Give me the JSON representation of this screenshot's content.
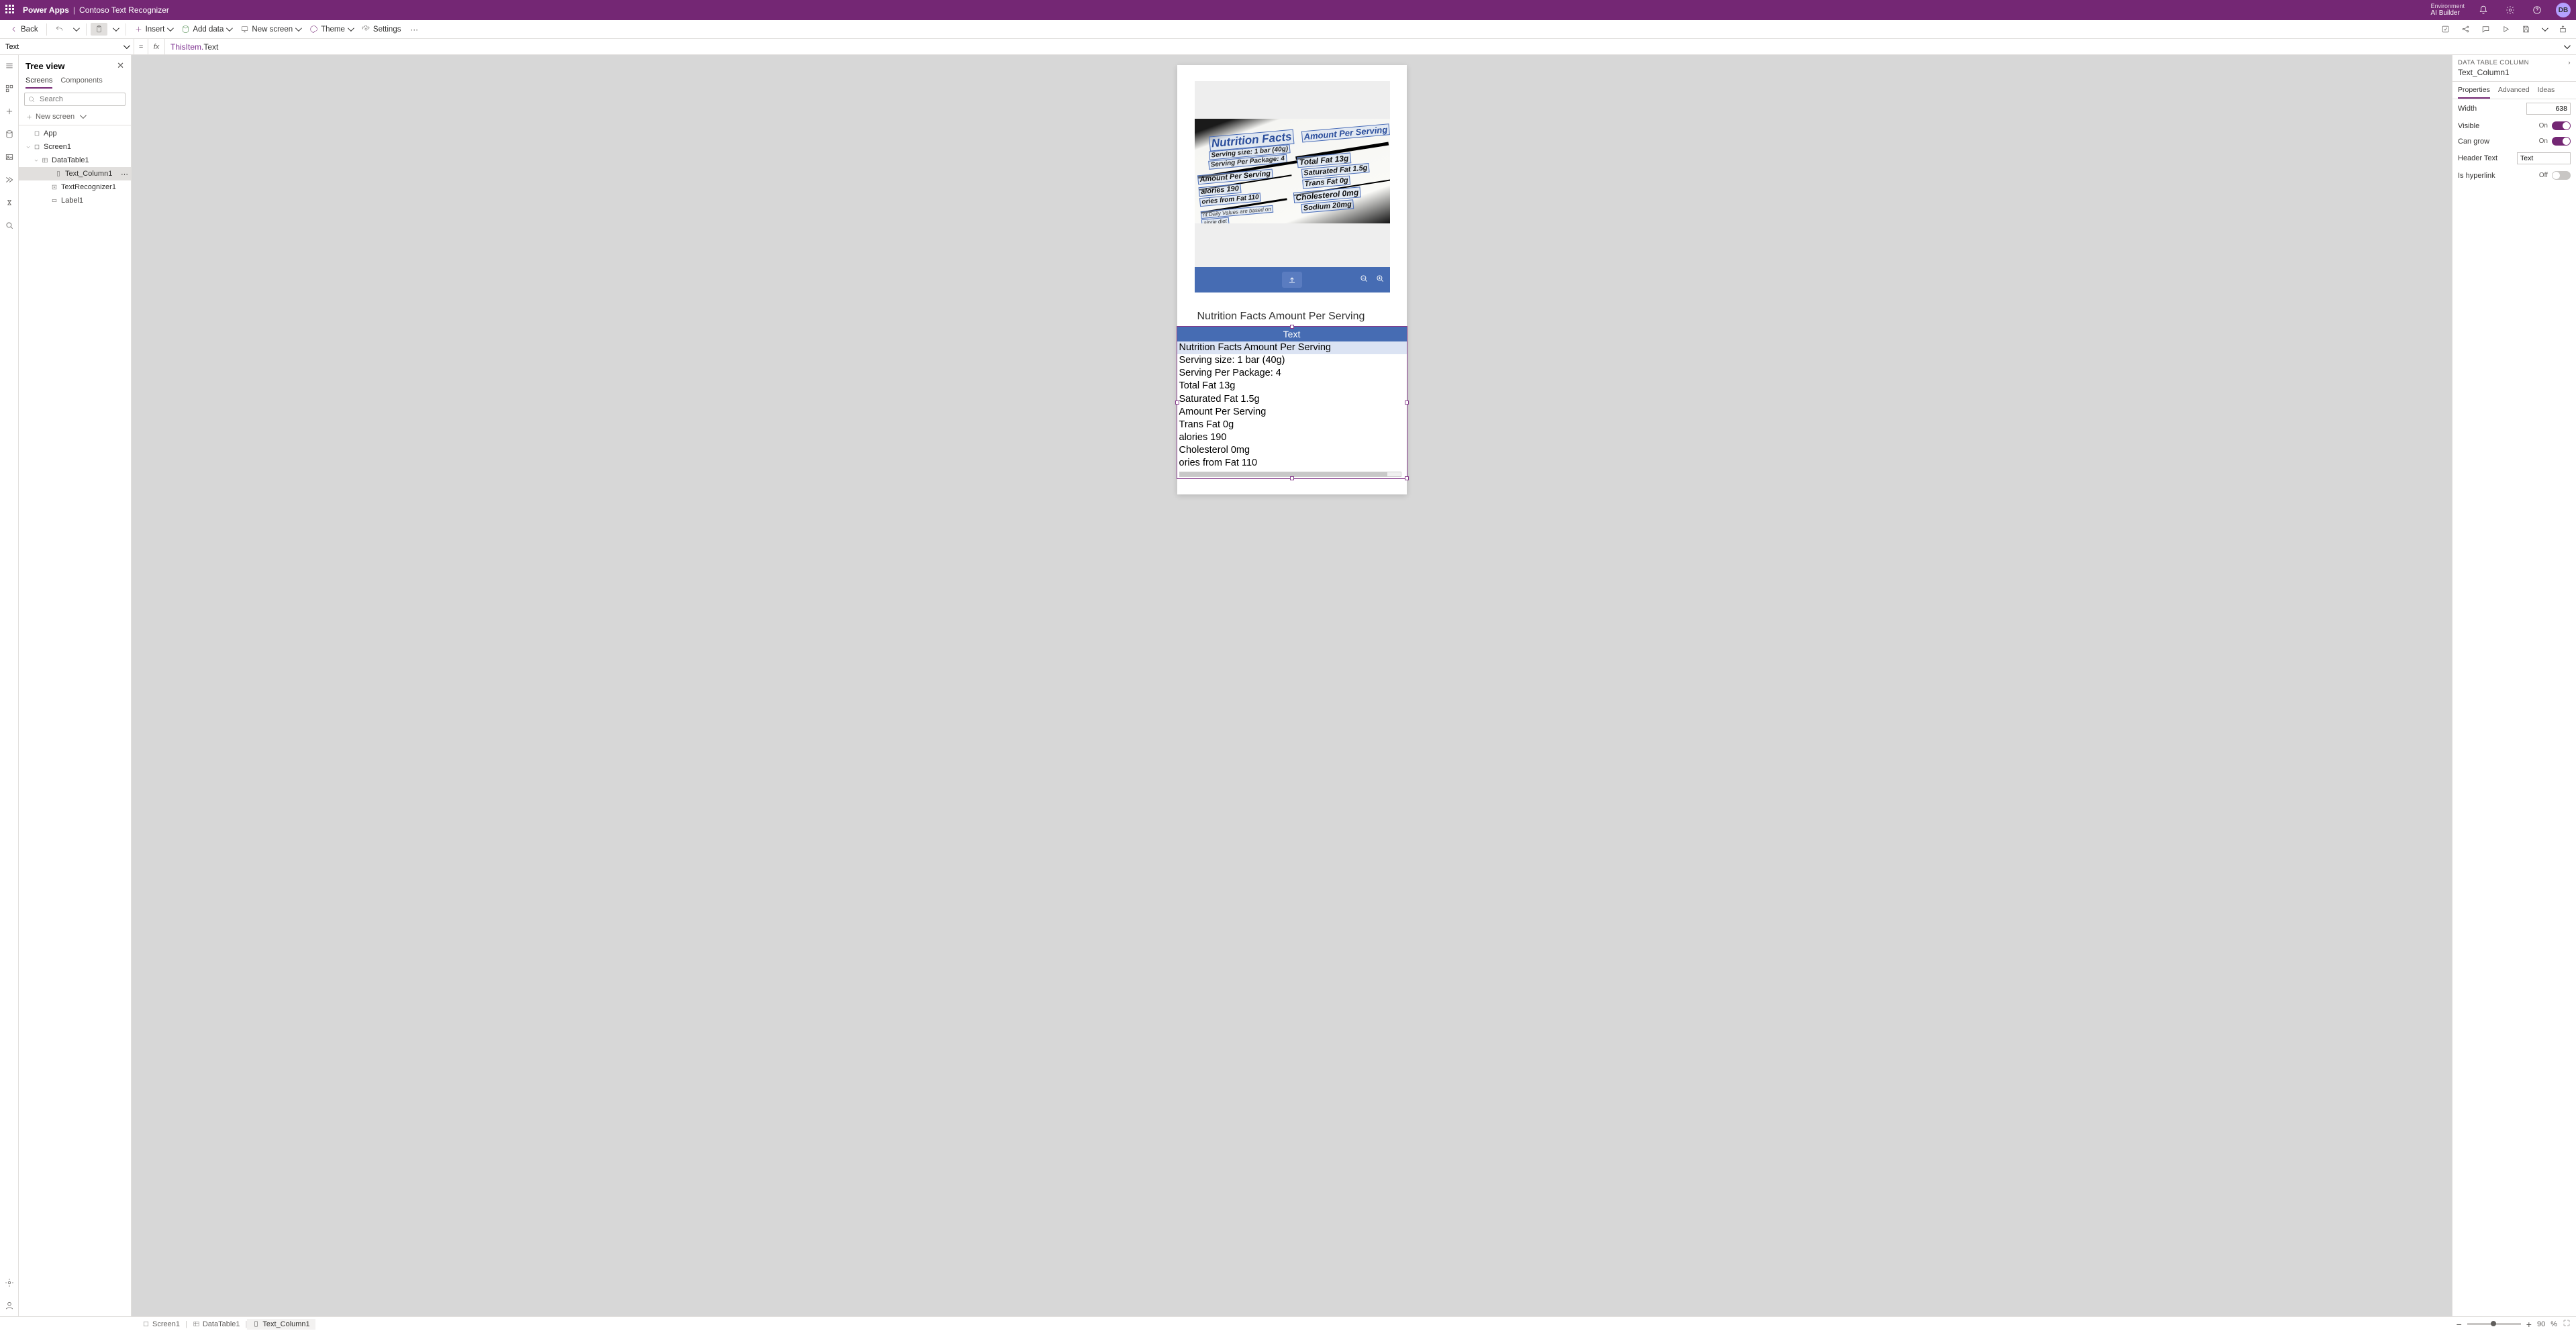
{
  "header": {
    "brand": "Power Apps",
    "appName": "Contoso Text Recognizer",
    "envLabel": "Environment",
    "envName": "AI Builder",
    "avatar": "DB"
  },
  "ribbon": {
    "back": "Back",
    "insert": "Insert",
    "addData": "Add data",
    "newScreen": "New screen",
    "theme": "Theme",
    "settings": "Settings"
  },
  "formula": {
    "property": "Text",
    "prefix": "ThisItem.",
    "suffix": "Text"
  },
  "treeview": {
    "title": "Tree view",
    "tabs": {
      "screens": "Screens",
      "components": "Components"
    },
    "searchPlaceholder": "Search",
    "newScreen": "New screen",
    "nodes": {
      "app": "App",
      "screen1": "Screen1",
      "dataTable1": "DataTable1",
      "textColumn1": "Text_Column1",
      "textRecognizer1": "TextRecognizer1",
      "label1": "Label1"
    }
  },
  "canvas": {
    "labelText": "Nutrition Facts Amount Per Serving",
    "columnHeader": "Text",
    "rows": [
      "Nutrition Facts Amount Per Serving",
      "Serving size: 1 bar (40g)",
      "Serving Per Package: 4",
      "Total Fat 13g",
      "Saturated Fat 1.5g",
      "Amount Per Serving",
      "Trans Fat 0g",
      "alories 190",
      "Cholesterol 0mg",
      "ories from Fat 110"
    ],
    "imageOcr": [
      "Nutrition Facts",
      "Amount Per Serving",
      "Serving size: 1 bar (40g)",
      "Serving Per Package: 4",
      "Amount Per Serving",
      "alories 190",
      "ories from Fat 110",
      "nt Daily Values are based on",
      "alorie diet",
      "Total Fat 13g",
      "Saturated Fat 1.5g",
      "Trans Fat 0g",
      "Cholesterol 0mg",
      "Sodium 20mg"
    ]
  },
  "props": {
    "category": "DATA TABLE COLUMN",
    "name": "Text_Column1",
    "tabs": {
      "properties": "Properties",
      "advanced": "Advanced",
      "ideas": "Ideas"
    },
    "width": {
      "label": "Width",
      "value": "638"
    },
    "visible": {
      "label": "Visible",
      "state": "On"
    },
    "canGrow": {
      "label": "Can grow",
      "state": "On"
    },
    "headerText": {
      "label": "Header Text",
      "value": "Text"
    },
    "isHyperlink": {
      "label": "Is hyperlink",
      "state": "Off"
    }
  },
  "status": {
    "crumbs": [
      "Screen1",
      "DataTable1",
      "Text_Column1"
    ],
    "zoom": "90",
    "pct": "%"
  }
}
